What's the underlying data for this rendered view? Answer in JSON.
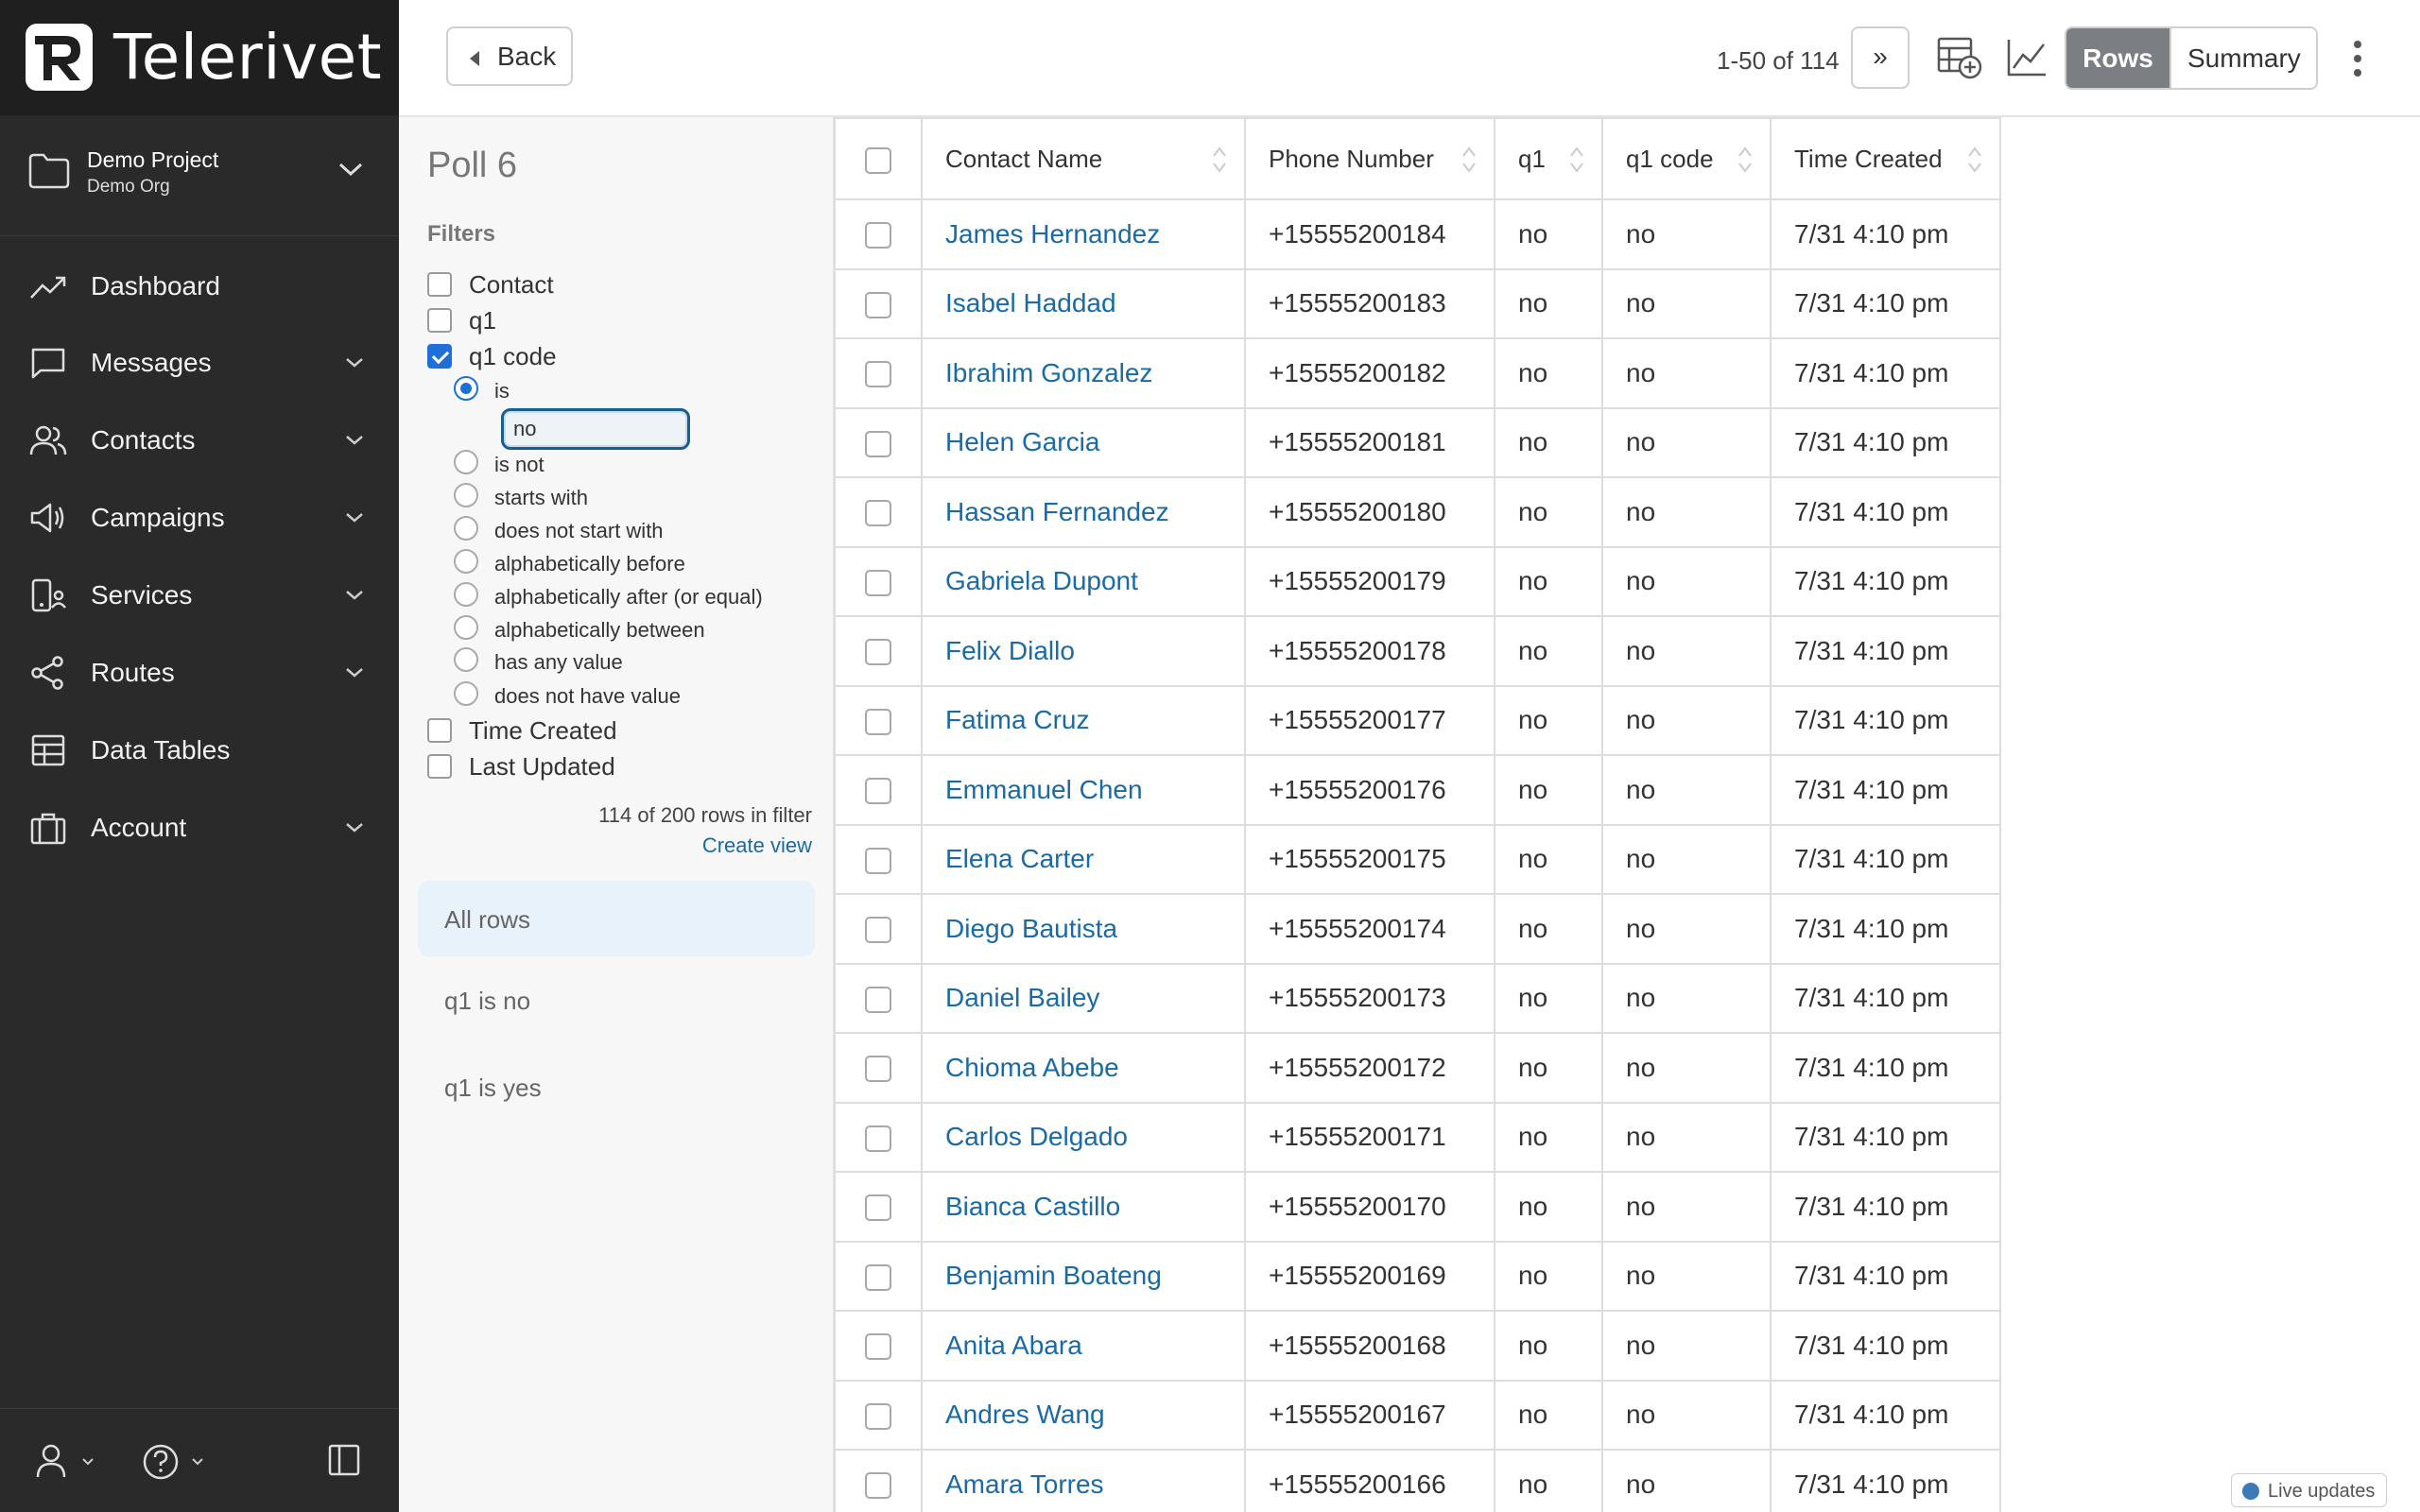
{
  "brand": {
    "name": "Telerivet"
  },
  "project": {
    "name": "Demo Project",
    "org": "Demo Org"
  },
  "nav": [
    {
      "label": "Dashboard",
      "icon": "trend-icon",
      "has_submenu": false
    },
    {
      "label": "Messages",
      "icon": "message-icon",
      "has_submenu": true
    },
    {
      "label": "Contacts",
      "icon": "contacts-icon",
      "has_submenu": true
    },
    {
      "label": "Campaigns",
      "icon": "megaphone-icon",
      "has_submenu": true
    },
    {
      "label": "Services",
      "icon": "services-icon",
      "has_submenu": true
    },
    {
      "label": "Routes",
      "icon": "share-icon",
      "has_submenu": true
    },
    {
      "label": "Data Tables",
      "icon": "table-icon",
      "has_submenu": false
    },
    {
      "label": "Account",
      "icon": "briefcase-icon",
      "has_submenu": true
    }
  ],
  "topbar": {
    "back_label": "Back",
    "pagination": "1-50 of 114",
    "next_label": "»",
    "rows_label": "Rows",
    "summary_label": "Summary"
  },
  "filter_panel": {
    "title": "Poll 6",
    "filters_heading": "Filters",
    "filters": [
      {
        "label": "Contact",
        "checked": false
      },
      {
        "label": "q1",
        "checked": false
      },
      {
        "label": "q1 code",
        "checked": true
      }
    ],
    "operators": [
      {
        "label": "is",
        "selected": true
      },
      {
        "label": "is not",
        "selected": false
      },
      {
        "label": "starts with",
        "selected": false
      },
      {
        "label": "does not start with",
        "selected": false
      },
      {
        "label": "alphabetically before",
        "selected": false
      },
      {
        "label": "alphabetically after (or equal)",
        "selected": false
      },
      {
        "label": "alphabetically between",
        "selected": false
      },
      {
        "label": "has any value",
        "selected": false
      },
      {
        "label": "does not have value",
        "selected": false
      }
    ],
    "filter_value": "no",
    "more_filters": [
      {
        "label": "Time Created",
        "checked": false
      },
      {
        "label": "Last Updated",
        "checked": false
      }
    ],
    "rows_count": "114 of 200 rows in filter",
    "create_view": "Create view",
    "views": [
      {
        "label": "All rows",
        "active": true
      },
      {
        "label": "q1 is no",
        "active": false
      },
      {
        "label": "q1 is yes",
        "active": false
      }
    ]
  },
  "table": {
    "columns": [
      "Contact Name",
      "Phone Number",
      "q1",
      "q1 code",
      "Time Created"
    ],
    "rows": [
      [
        "James Hernandez",
        "+15555200184",
        "no",
        "no",
        "7/31 4:10 pm"
      ],
      [
        "Isabel Haddad",
        "+15555200183",
        "no",
        "no",
        "7/31 4:10 pm"
      ],
      [
        "Ibrahim Gonzalez",
        "+15555200182",
        "no",
        "no",
        "7/31 4:10 pm"
      ],
      [
        "Helen Garcia",
        "+15555200181",
        "no",
        "no",
        "7/31 4:10 pm"
      ],
      [
        "Hassan Fernandez",
        "+15555200180",
        "no",
        "no",
        "7/31 4:10 pm"
      ],
      [
        "Gabriela Dupont",
        "+15555200179",
        "no",
        "no",
        "7/31 4:10 pm"
      ],
      [
        "Felix Diallo",
        "+15555200178",
        "no",
        "no",
        "7/31 4:10 pm"
      ],
      [
        "Fatima Cruz",
        "+15555200177",
        "no",
        "no",
        "7/31 4:10 pm"
      ],
      [
        "Emmanuel Chen",
        "+15555200176",
        "no",
        "no",
        "7/31 4:10 pm"
      ],
      [
        "Elena Carter",
        "+15555200175",
        "no",
        "no",
        "7/31 4:10 pm"
      ],
      [
        "Diego Bautista",
        "+15555200174",
        "no",
        "no",
        "7/31 4:10 pm"
      ],
      [
        "Daniel Bailey",
        "+15555200173",
        "no",
        "no",
        "7/31 4:10 pm"
      ],
      [
        "Chioma Abebe",
        "+15555200172",
        "no",
        "no",
        "7/31 4:10 pm"
      ],
      [
        "Carlos Delgado",
        "+15555200171",
        "no",
        "no",
        "7/31 4:10 pm"
      ],
      [
        "Bianca Castillo",
        "+15555200170",
        "no",
        "no",
        "7/31 4:10 pm"
      ],
      [
        "Benjamin Boateng",
        "+15555200169",
        "no",
        "no",
        "7/31 4:10 pm"
      ],
      [
        "Anita Abara",
        "+15555200168",
        "no",
        "no",
        "7/31 4:10 pm"
      ],
      [
        "Andres Wang",
        "+15555200167",
        "no",
        "no",
        "7/31 4:10 pm"
      ],
      [
        "Amara Torres",
        "+15555200166",
        "no",
        "no",
        "7/31 4:10 pm"
      ]
    ]
  },
  "live_updates": "Live updates",
  "colors": {
    "sidebar_bg": "#2a2a2a",
    "link": "#1a6aa5",
    "accent": "#1f6fd8",
    "active_toggle": "#7b7f84",
    "active_view_bg": "#e8f2fa"
  }
}
